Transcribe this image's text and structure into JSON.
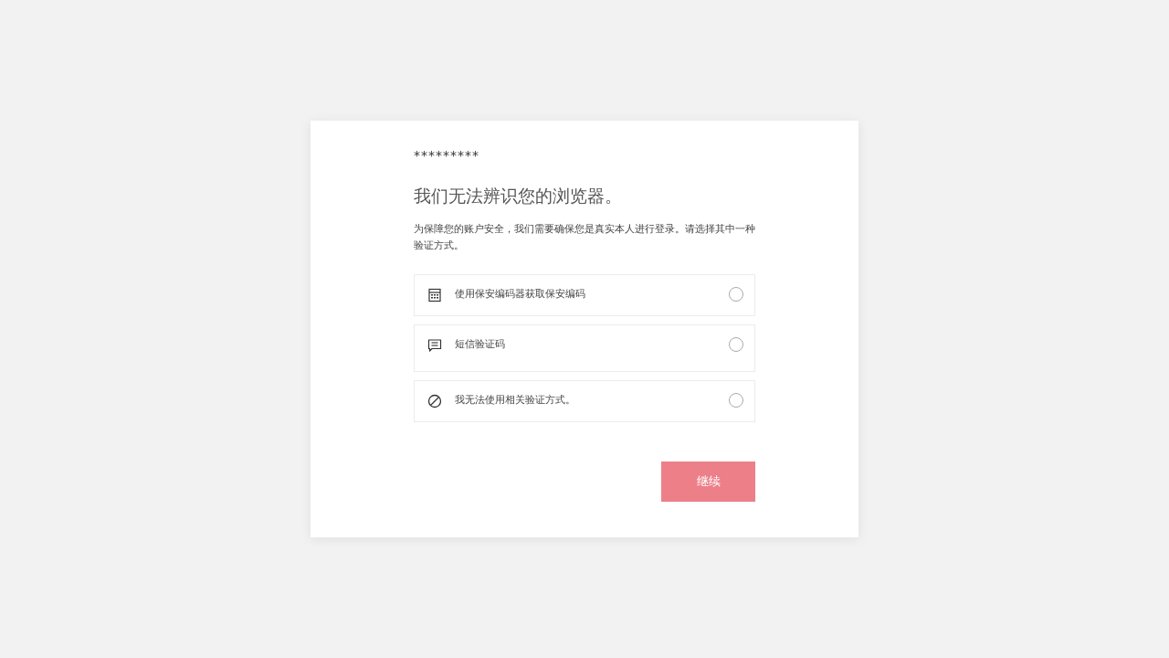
{
  "account": "*********",
  "title": "我们无法辨识您的浏览器。",
  "description": "为保障您的账户安全，我们需要确保您是真实本人进行登录。请选择其中一种验证方式。",
  "options": [
    {
      "kind": "calculator",
      "label": "使用保安编码器获取保安编码",
      "selected": false
    },
    {
      "kind": "message",
      "label": "短信验证码",
      "selected": false
    },
    {
      "kind": "blocked",
      "label": "我无法使用相关验证方式。",
      "selected": false
    }
  ],
  "button": "继续"
}
